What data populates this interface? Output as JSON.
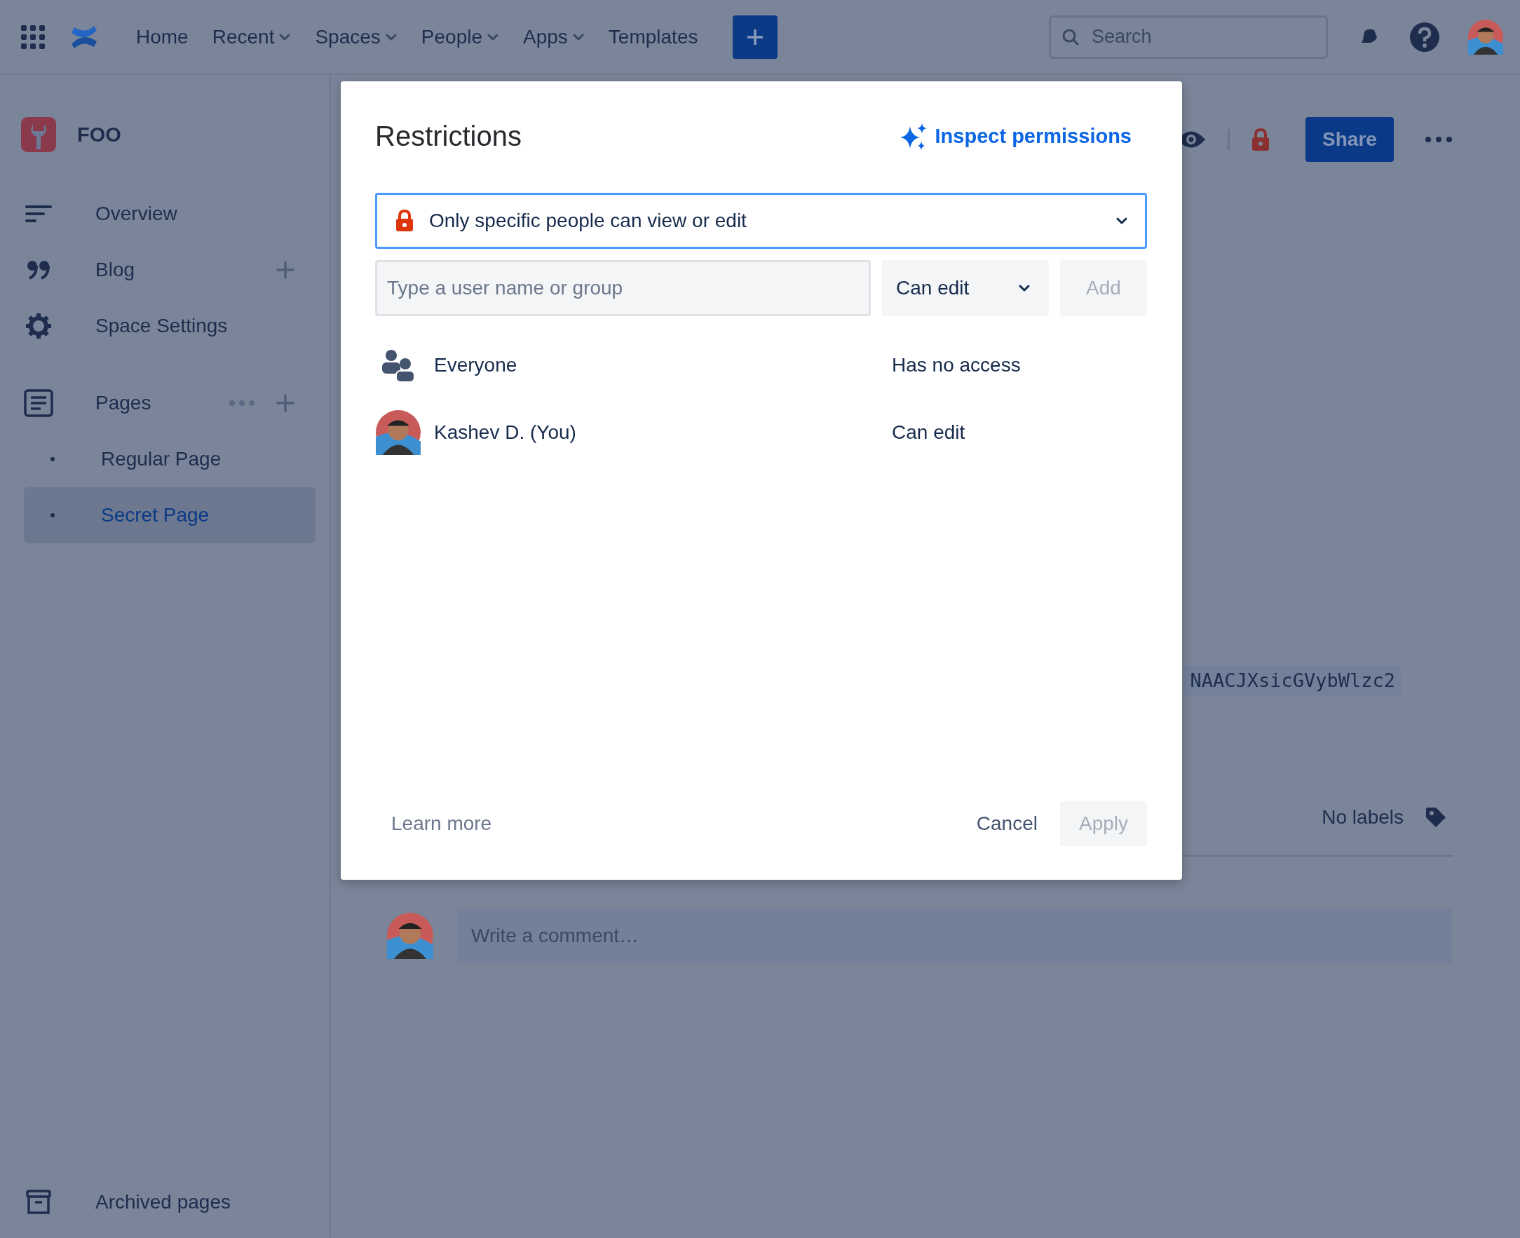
{
  "top_nav": {
    "items": [
      {
        "label": "Home",
        "has_menu": false
      },
      {
        "label": "Recent",
        "has_menu": true
      },
      {
        "label": "Spaces",
        "has_menu": true
      },
      {
        "label": "People",
        "has_menu": true
      },
      {
        "label": "Apps",
        "has_menu": true
      },
      {
        "label": "Templates",
        "has_menu": false
      }
    ],
    "search": {
      "placeholder": "Search"
    }
  },
  "sidebar": {
    "space": {
      "name": "FOO"
    },
    "items": [
      {
        "label": "Overview",
        "kind": "overview",
        "has_add": false
      },
      {
        "label": "Blog",
        "kind": "blog",
        "has_add": true
      },
      {
        "label": "Space Settings",
        "kind": "settings",
        "has_add": false
      }
    ],
    "pages": {
      "label": "Pages",
      "children": [
        {
          "label": "Regular Page",
          "selected": false
        },
        {
          "label": "Secret Page",
          "selected": true
        }
      ]
    },
    "footer": {
      "label": "Archived pages"
    }
  },
  "page": {
    "share_button": "Share",
    "code_snippet": "NAACJXsicGVybWlzc2",
    "labels_text": "No labels",
    "comment": {
      "placeholder": "Write a comment…"
    }
  },
  "dialog": {
    "title": "Restrictions",
    "inspect_link": "Inspect permissions",
    "restriction_select": {
      "value": "Only specific people can view or edit"
    },
    "user_field": {
      "placeholder": "Type a user name or group"
    },
    "permission_select": {
      "value": "Can edit"
    },
    "add_button": {
      "label": "Add",
      "disabled": true
    },
    "entries": [
      {
        "name": "Everyone",
        "kind": "group",
        "access": "Has no access"
      },
      {
        "name": "Kashev D. (You)",
        "kind": "user",
        "access": "Can edit"
      }
    ],
    "learn_more": "Learn more",
    "cancel_button": "Cancel",
    "apply_button": {
      "label": "Apply",
      "disabled": true
    }
  }
}
